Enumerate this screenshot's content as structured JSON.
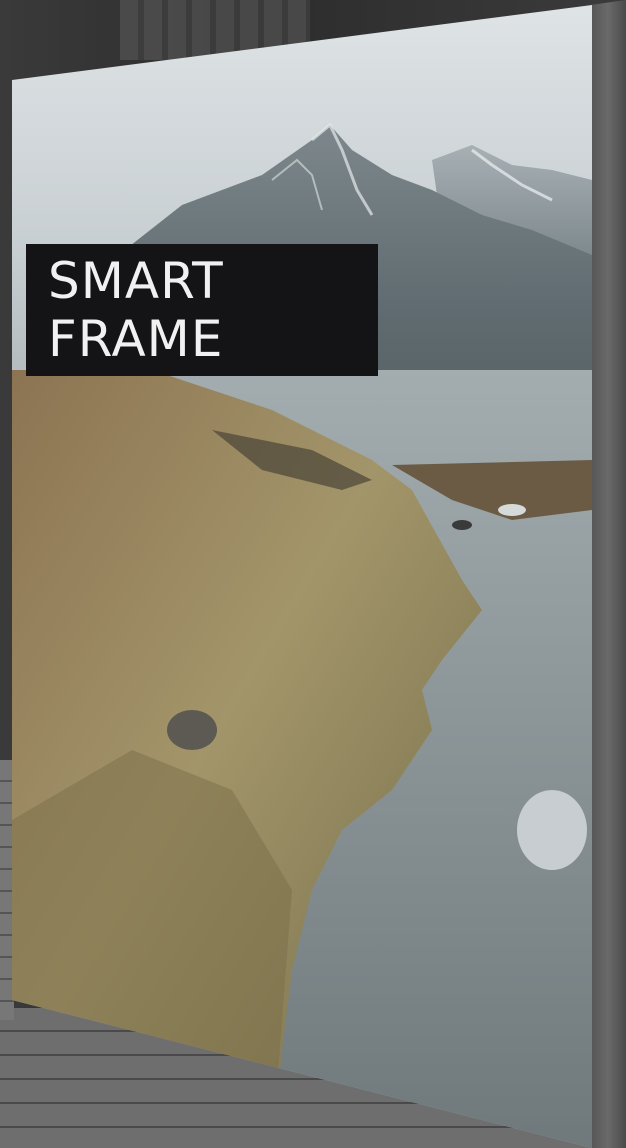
{
  "frame": {
    "label": "SMART FRAME"
  },
  "colors": {
    "label_background": "#141416",
    "label_text": "#f1f1f1",
    "water": "#8f999d",
    "grass": "#9a8a60"
  }
}
